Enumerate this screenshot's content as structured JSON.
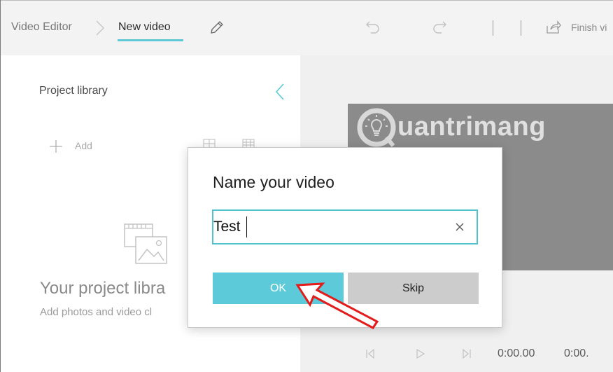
{
  "header": {
    "breadcrumb_root": "Video Editor",
    "breadcrumb_current": "New video",
    "finish_label": "Finish vi"
  },
  "library": {
    "title": "Project library",
    "add_label": "Add",
    "empty_title": "Your project libra",
    "empty_subtitle": "Add photos and video cl"
  },
  "preview": {
    "watermark_text": "uantrimang"
  },
  "playback": {
    "current_time": "0:00.00",
    "total_time": "0:00."
  },
  "dialog": {
    "title": "Name your video",
    "input_value": "Test",
    "ok_label": "OK",
    "skip_label": "Skip"
  },
  "colors": {
    "accent": "#5ccad8",
    "input_border": "#52c2cf",
    "annotation_arrow": "#e31b1b",
    "preview_bg": "#8b8b8b"
  },
  "icons": [
    "chevron-right-icon",
    "pencil-icon",
    "undo-icon",
    "redo-icon",
    "share-icon",
    "chevron-left-icon",
    "plus-icon",
    "grid-small-icon",
    "grid-large-icon",
    "library-media-icon",
    "lightbulb-logo-icon",
    "previous-frame-icon",
    "play-icon",
    "next-frame-icon",
    "clear-icon",
    "red-arrow-icon"
  ]
}
